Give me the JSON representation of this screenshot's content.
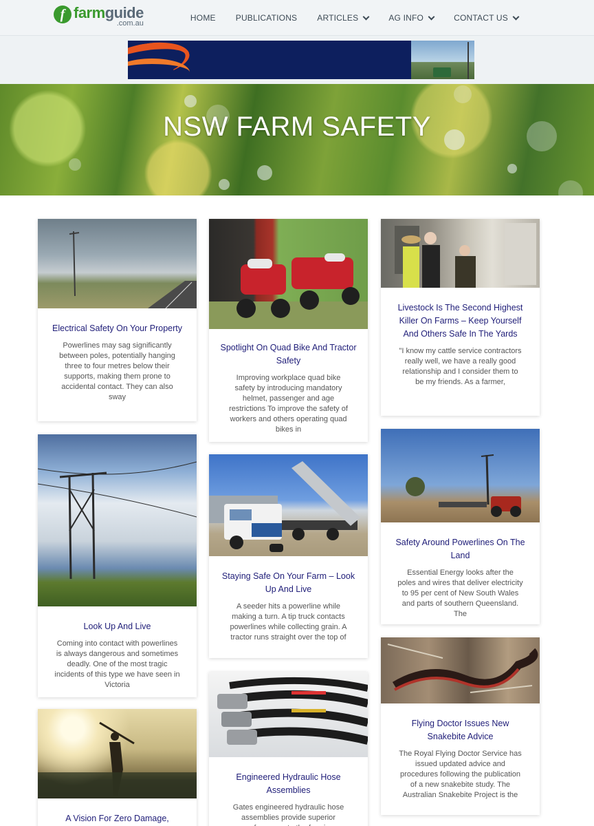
{
  "brand": {
    "mark": "f",
    "name_a": "farm",
    "name_b": "guide",
    "sub": ".com.au"
  },
  "nav": [
    {
      "label": "HOME",
      "dropdown": false
    },
    {
      "label": "PUBLICATIONS",
      "dropdown": false
    },
    {
      "label": "ARTICLES",
      "dropdown": true
    },
    {
      "label": "AG INFO",
      "dropdown": true
    },
    {
      "label": "CONTACT US",
      "dropdown": true
    }
  ],
  "hero": {
    "title": "NSW FARM SAFETY"
  },
  "cards": [
    {
      "title": "Electrical Safety On Your Property",
      "excerpt": "Powerlines may sag significantly between poles, potentially hanging three to four metres below their supports, making them prone to accidental contact. They can also sway"
    },
    {
      "title": "Spotlight On Quad Bike And Tractor Safety",
      "excerpt": "Improving workplace quad bike safety by introducing mandatory helmet, passenger and age restrictions To improve the safety of workers and others operating quad bikes in"
    },
    {
      "title": "Livestock Is The Second Highest Killer On Farms – Keep Yourself And Others Safe In The Yards",
      "excerpt": "\"I know my cattle service contractors really well, we have a really good relationship and I consider them to be my friends. As a farmer,"
    },
    {
      "title": "Look Up And Live",
      "excerpt": "Coming into contact with powerlines is always dangerous and sometimes deadly. One of the most tragic incidents of this type we have seen in Victoria"
    },
    {
      "title": "Staying Safe On Your Farm – Look Up And Live",
      "excerpt": "A seeder hits a powerline while making a turn. A tip truck contacts powerlines while collecting grain. A tractor runs straight over the top of"
    },
    {
      "title": "Safety Around Powerlines On The Land",
      "excerpt": "Essential Energy looks after the poles and wires that deliver electricity to 95 per cent of New South Wales and parts of southern Queensland. The"
    },
    {
      "title": "A Vision For Zero Damage,",
      "excerpt": ""
    },
    {
      "title": "Engineered Hydraulic Hose Assemblies",
      "excerpt": "Gates engineered hydraulic hose assemblies provide superior performance to the farming"
    },
    {
      "title": "Flying Doctor Issues New Snakebite Advice",
      "excerpt": "The Royal Flying Doctor Service has issued updated advice and procedures following the publication of a new snakebite study. The Australian Snakebite Project is the"
    }
  ],
  "colors": {
    "accent": "#3a9a2e",
    "title_link": "#22207a",
    "ad_navy": "#0d1f5e",
    "ad_orange": "#e8541e"
  }
}
